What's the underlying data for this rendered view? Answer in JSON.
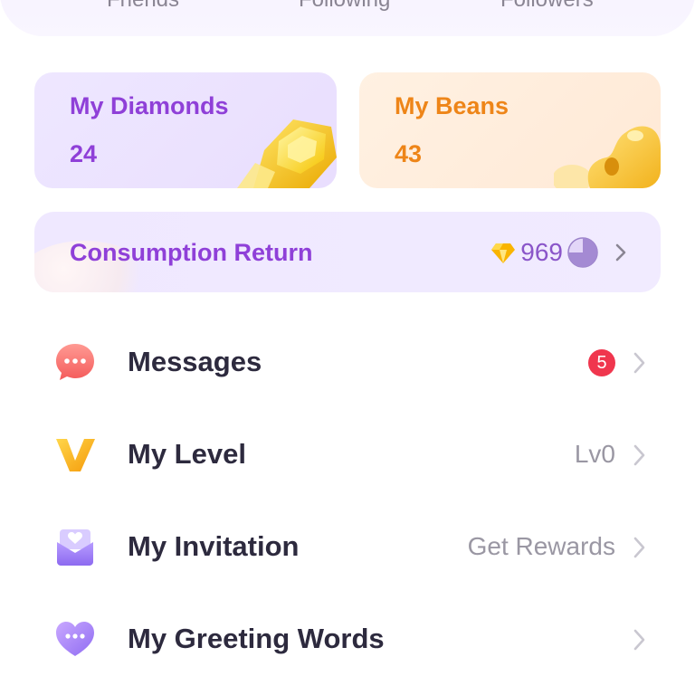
{
  "header": {
    "stats": [
      {
        "label": "Friends"
      },
      {
        "label": "Following"
      },
      {
        "label": "Followers"
      }
    ]
  },
  "cards": {
    "diamonds": {
      "title": "My Diamonds",
      "value": "24",
      "icon": "diamond-icon"
    },
    "beans": {
      "title": "My Beans",
      "value": "43",
      "icon": "bean-icon"
    }
  },
  "consumption": {
    "title": "Consumption Return",
    "value": "969",
    "icons": [
      "gem-icon",
      "progress-pie-icon",
      "chevron-right-icon"
    ]
  },
  "menu": {
    "items": [
      {
        "label": "Messages",
        "badge": "5",
        "icon": "chat-bubble-icon"
      },
      {
        "label": "My Level",
        "value": "Lv0",
        "icon": "v-level-icon"
      },
      {
        "label": "My Invitation",
        "value": "Get Rewards",
        "icon": "envelope-heart-icon"
      },
      {
        "label": "My Greeting Words",
        "icon": "heart-chat-icon"
      }
    ]
  },
  "colors": {
    "purple_accent": "#8f40d8",
    "orange_accent": "#ee8518",
    "badge_red": "#f0364e",
    "menu_text": "#2d2a3e",
    "muted_text": "#9a97a3"
  }
}
